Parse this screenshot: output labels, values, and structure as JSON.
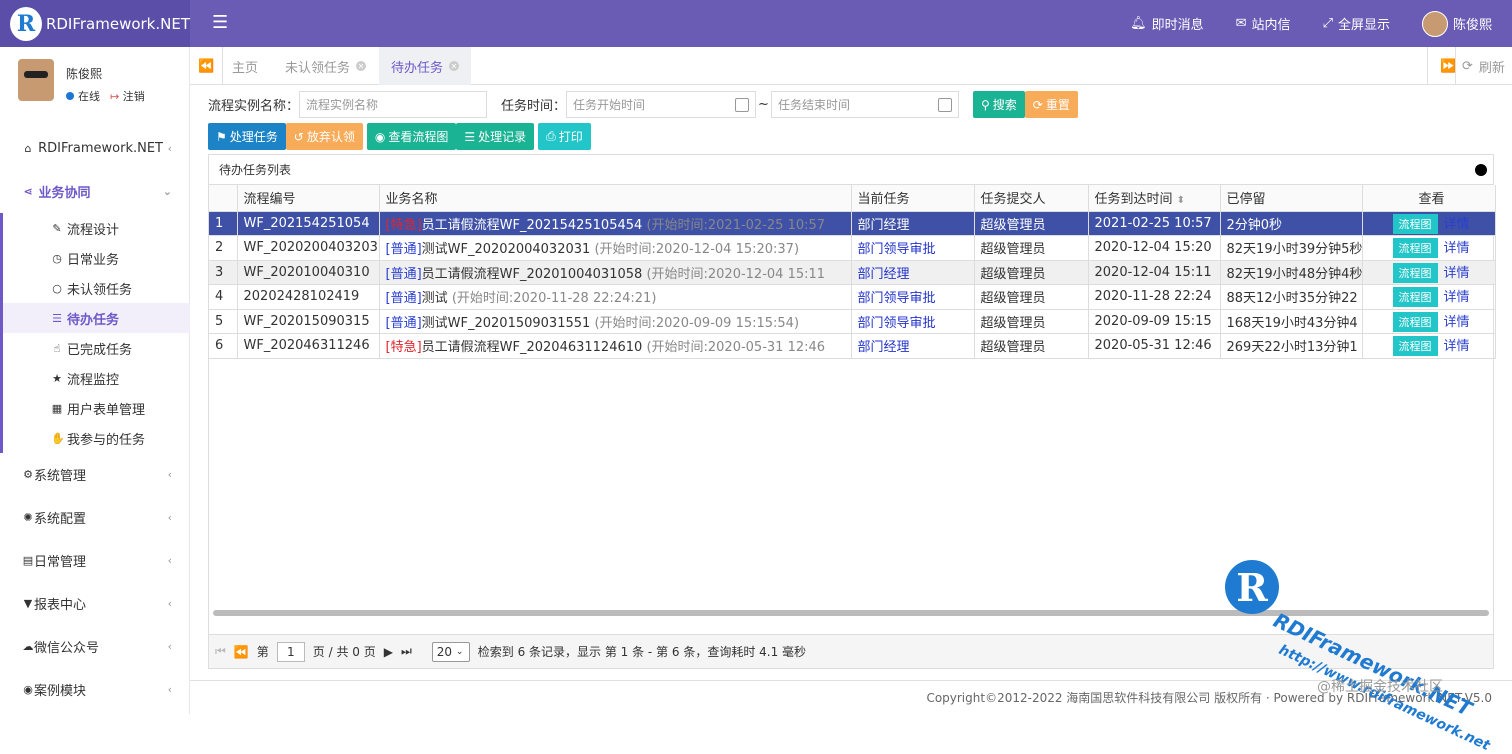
{
  "header": {
    "brand": "RDIFramework.NET",
    "nav": {
      "messages": "即时消息",
      "mail": "站内信",
      "fullscreen": "全屏显示",
      "user": "陈俊熙"
    }
  },
  "sidebar": {
    "user": {
      "name": "陈俊熙",
      "status": "在线",
      "logout": "注销"
    },
    "menu": [
      "RDIFramework.NET",
      "业务协同"
    ],
    "sub": [
      "流程设计",
      "日常业务",
      "未认领任务",
      "待办任务",
      "已完成任务",
      "流程监控",
      "用户表单管理",
      "我参与的任务"
    ],
    "bottom": [
      "系统管理",
      "系统配置",
      "日常管理",
      "报表中心",
      "微信公众号",
      "案例模块"
    ]
  },
  "tabs": [
    "主页",
    "未认领任务",
    "待办任务"
  ],
  "refresh": "刷新",
  "search": {
    "name_label": "流程实例名称：",
    "name_ph": "流程实例名称",
    "time_label": "任务时间：",
    "start_ph": "任务开始时间",
    "sep": "~",
    "end_ph": "任务结束时间",
    "search_btn": "搜索",
    "reset_btn": "重置"
  },
  "toolbar": {
    "handle": "处理任务",
    "abandon": "放弃认领",
    "view_flow": "查看流程图",
    "records": "处理记录",
    "print": "打印"
  },
  "grid": {
    "title": "待办任务列表",
    "columns": [
      "流程编号",
      "业务名称",
      "当前任务",
      "任务提交人",
      "任务到达时间",
      "已停留",
      "查看"
    ],
    "rows": [
      {
        "n": "1",
        "code": "WF_202154251054",
        "tag": "[特急]",
        "name": "员工请假流程WF_20215425105454",
        "start": "(开始时间:2021-02-25 10:57",
        "cur": "部门经理",
        "sub": "超级管理员",
        "time": "2021-02-25 10:57",
        "stay": "2分钟0秒"
      },
      {
        "n": "2",
        "code": "WF_2020200403203",
        "tag": "[普通]",
        "name": "测试WF_20202004032031",
        "start": "(开始时间:2020-12-04 15:20:37)",
        "cur": "部门领导审批",
        "sub": "超级管理员",
        "time": "2020-12-04 15:20",
        "stay": "82天19小时39分钟5秒"
      },
      {
        "n": "3",
        "code": "WF_202010040310",
        "tag": "[普通]",
        "name": "员工请假流程WF_20201004031058",
        "start": "(开始时间:2020-12-04 15:11",
        "cur": "部门经理",
        "sub": "超级管理员",
        "time": "2020-12-04 15:11",
        "stay": "82天19小时48分钟4秒"
      },
      {
        "n": "4",
        "code": "20202428102419",
        "tag": "[普通]",
        "name": "测试",
        "start": "(开始时间:2020-11-28 22:24:21)",
        "cur": "部门领导审批",
        "sub": "超级管理员",
        "time": "2020-11-28 22:24",
        "stay": "88天12小时35分钟22"
      },
      {
        "n": "5",
        "code": "WF_202015090315",
        "tag": "[普通]",
        "name": "测试WF_20201509031551",
        "start": "(开始时间:2020-09-09 15:15:54)",
        "cur": "部门领导审批",
        "sub": "超级管理员",
        "time": "2020-09-09 15:15",
        "stay": "168天19小时43分钟4"
      },
      {
        "n": "6",
        "code": "WF_202046311246",
        "tag": "[特急]",
        "name": "员工请假流程WF_20204631124610",
        "start": "(开始时间:2020-05-31 12:46",
        "cur": "部门经理",
        "sub": "超级管理员",
        "time": "2020-05-31 12:46",
        "stay": "269天22小时13分钟1"
      }
    ],
    "flow_btn": "流程图",
    "detail_link": "详情"
  },
  "pager": {
    "page_pre": "第",
    "page": "1",
    "page_post": "页 / 共 0 页",
    "size": "20",
    "info": "检索到 6 条记录，显示 第 1 条 - 第 6 条，查询耗时 4.1 毫秒"
  },
  "footer": "Copyright©2012-2022 海南国思软件科技有限公司 版权所有 · Powered by RDIFramework.NET-V5.0",
  "watermark": {
    "line1": "RDIFramework.NET",
    "line2": "http://www.rdiframework.net",
    "line3": "@稀土掘金技术社区"
  }
}
